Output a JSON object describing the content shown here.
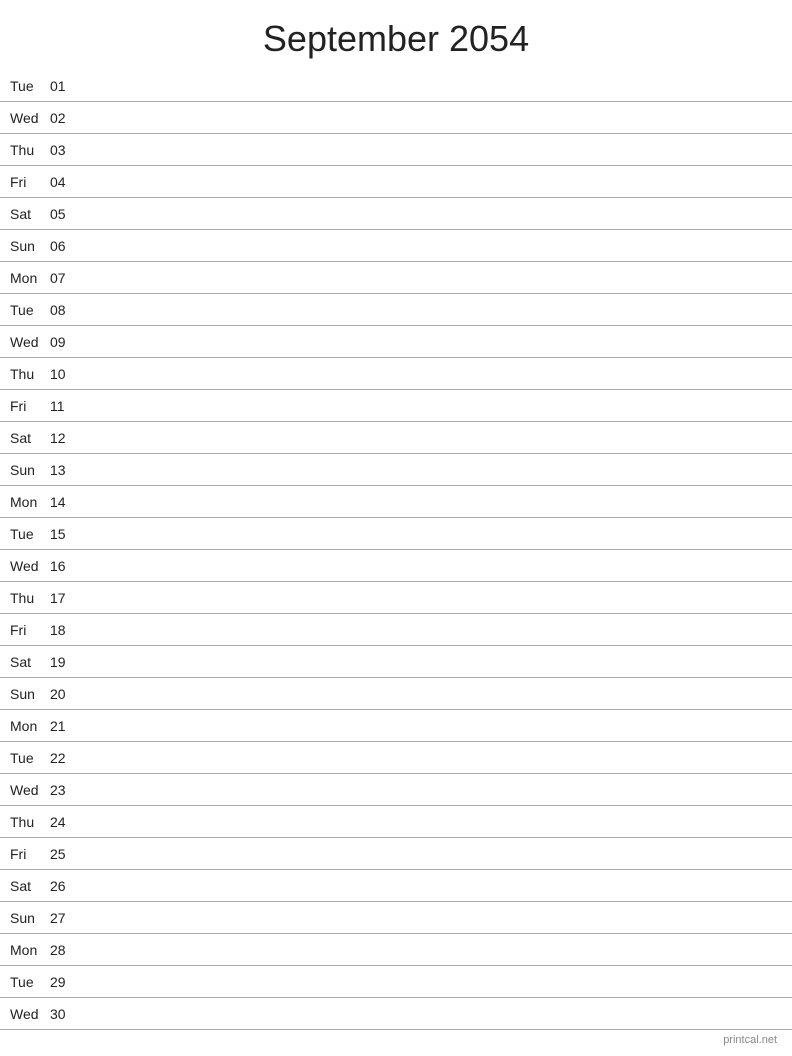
{
  "header": {
    "title": "September 2054"
  },
  "days": [
    {
      "name": "Tue",
      "number": "01"
    },
    {
      "name": "Wed",
      "number": "02"
    },
    {
      "name": "Thu",
      "number": "03"
    },
    {
      "name": "Fri",
      "number": "04"
    },
    {
      "name": "Sat",
      "number": "05"
    },
    {
      "name": "Sun",
      "number": "06"
    },
    {
      "name": "Mon",
      "number": "07"
    },
    {
      "name": "Tue",
      "number": "08"
    },
    {
      "name": "Wed",
      "number": "09"
    },
    {
      "name": "Thu",
      "number": "10"
    },
    {
      "name": "Fri",
      "number": "11"
    },
    {
      "name": "Sat",
      "number": "12"
    },
    {
      "name": "Sun",
      "number": "13"
    },
    {
      "name": "Mon",
      "number": "14"
    },
    {
      "name": "Tue",
      "number": "15"
    },
    {
      "name": "Wed",
      "number": "16"
    },
    {
      "name": "Thu",
      "number": "17"
    },
    {
      "name": "Fri",
      "number": "18"
    },
    {
      "name": "Sat",
      "number": "19"
    },
    {
      "name": "Sun",
      "number": "20"
    },
    {
      "name": "Mon",
      "number": "21"
    },
    {
      "name": "Tue",
      "number": "22"
    },
    {
      "name": "Wed",
      "number": "23"
    },
    {
      "name": "Thu",
      "number": "24"
    },
    {
      "name": "Fri",
      "number": "25"
    },
    {
      "name": "Sat",
      "number": "26"
    },
    {
      "name": "Sun",
      "number": "27"
    },
    {
      "name": "Mon",
      "number": "28"
    },
    {
      "name": "Tue",
      "number": "29"
    },
    {
      "name": "Wed",
      "number": "30"
    }
  ],
  "footer": {
    "text": "printcal.net"
  }
}
